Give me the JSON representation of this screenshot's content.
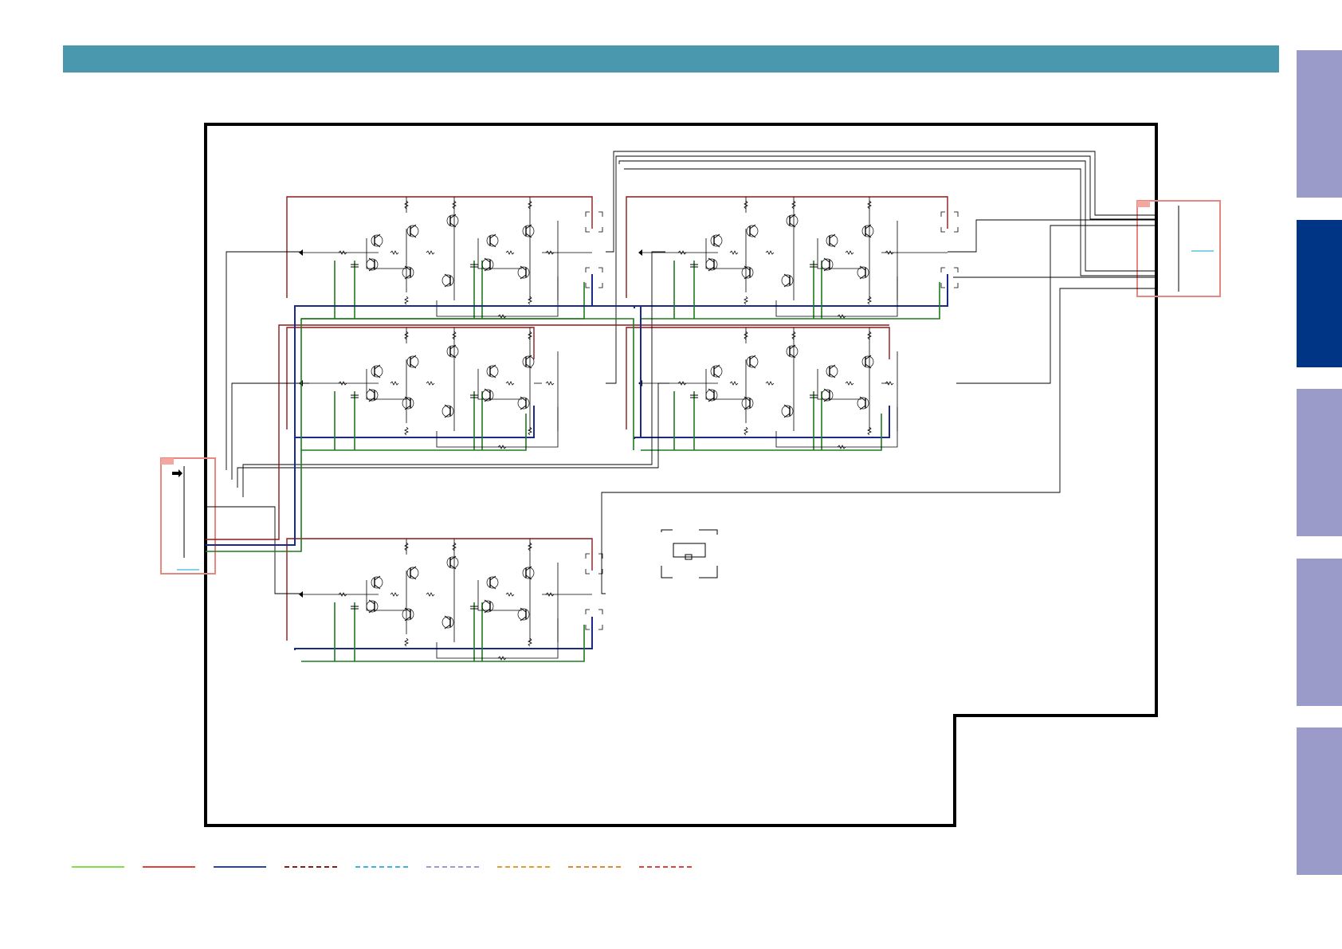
{
  "header": {
    "color": "#4a98ae"
  },
  "side_tabs": [
    {
      "name": "tab-1",
      "state": "inactive",
      "color": "#9b9bc9"
    },
    {
      "name": "tab-2",
      "state": "active",
      "color": "#003586"
    },
    {
      "name": "tab-3",
      "state": "inactive",
      "color": "#9b9bc9"
    },
    {
      "name": "tab-4",
      "state": "inactive",
      "color": "#9b9bc9"
    },
    {
      "name": "tab-5",
      "state": "inactive",
      "color": "#9b9bc9"
    }
  ],
  "schematic": {
    "board_outline_color": "#000000",
    "supply_positive_color": "#8b1a1a",
    "supply_negative_color": "#1a2a8b",
    "ground_color": "#1f7a1f",
    "connector_box_color": "#e8877f",
    "amplifier_channel_count": 5
  },
  "legend": [
    {
      "style": "solid",
      "color": "#7ee04a"
    },
    {
      "style": "solid",
      "color": "#e0413a"
    },
    {
      "style": "solid",
      "color": "#2a44a8"
    },
    {
      "style": "dashed",
      "color": "#8b1a1a"
    },
    {
      "style": "dashed",
      "color": "#3bb6d8"
    },
    {
      "style": "dashed",
      "color": "#a397d6"
    },
    {
      "style": "dashed",
      "color": "#e0a030"
    },
    {
      "style": "dashed",
      "color": "#e08a30"
    },
    {
      "style": "dashed",
      "color": "#e0413a"
    }
  ]
}
